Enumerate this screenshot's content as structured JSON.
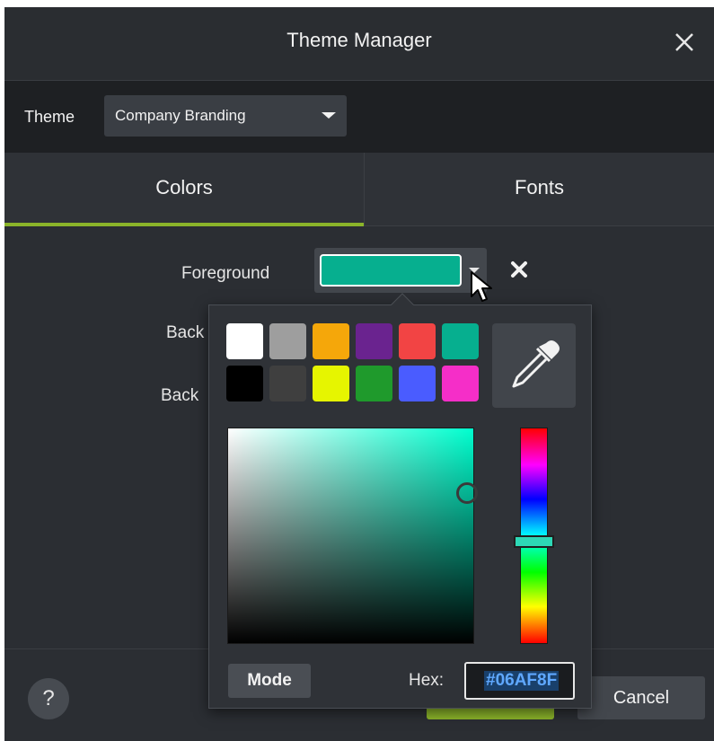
{
  "dialog": {
    "title": "Theme Manager",
    "close_icon": "close-icon"
  },
  "theme_bar": {
    "label": "Theme",
    "selected": "Company Branding"
  },
  "tabs": [
    {
      "label": "Colors",
      "active": true
    },
    {
      "label": "Fonts",
      "active": false
    }
  ],
  "properties": {
    "foreground_label": "Foreground",
    "background1_label_visible": "Back",
    "background2_label_visible": "Back",
    "foreground_color": "#06AF8F"
  },
  "color_popup": {
    "swatches_row1": [
      "#ffffff",
      "#9e9e9e",
      "#f5a70a",
      "#6a238f",
      "#f24444",
      "#06af8f"
    ],
    "swatches_row2": [
      "#000000",
      "#3f3f3f",
      "#e6f500",
      "#1f9a2c",
      "#4a5cff",
      "#f52ec8"
    ],
    "mode_label": "Mode",
    "hex_label": "Hex:",
    "hex_value": "#06AF8F",
    "eyedropper_icon": "eyedropper-icon"
  },
  "footer": {
    "help_label": "?",
    "cancel_label": "Cancel",
    "accent_color": "#8bb42a"
  }
}
